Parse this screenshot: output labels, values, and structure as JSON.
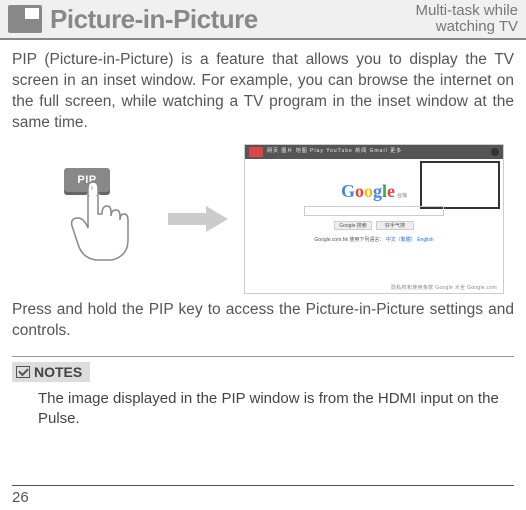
{
  "header": {
    "title": "Picture-in-Picture",
    "subtitle_line1": "Multi-task while",
    "subtitle_line2": "watching TV"
  },
  "intro": "PIP (Picture-in-Picture) is a feature that allows you to display the TV screen in an inset window. For example, you can browse the internet on the full screen, while watching a TV program in the inset window at the same time.",
  "pip_key_label": "PIP",
  "browser": {
    "tabs": "网页  图片  地图  Play  YouTube  新闻  Gmail  更多",
    "logo_suffix": "台灣",
    "btn1": "Google 搜索",
    "btn2": "好手气搜",
    "lang_prefix": "Google.com.hk 使用下列语言：",
    "lang1": "中文（繁體）",
    "lang2": "English",
    "footer_links": "隐私权和使用条款    Google 大全    Google.com"
  },
  "instruction2": "Press and hold the PIP key to access the Picture-in-Picture settings and controls.",
  "notes": {
    "label": "NOTES",
    "text": "The image displayed in the PIP window is from the HDMI input on the Pulse."
  },
  "page_number": "26"
}
